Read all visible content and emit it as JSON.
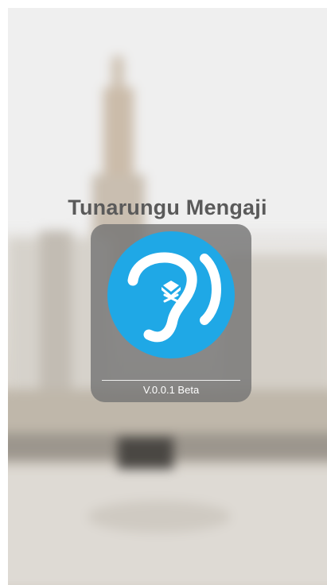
{
  "splash": {
    "app_title": "Tunarungu Mengaji",
    "version": "V.0.0.1 Beta"
  },
  "icons": {
    "logo": "ear-with-quran-icon"
  },
  "colors": {
    "logo_circle": "#1fa8e6",
    "title_text": "#5a5a5a",
    "card_background": "#737373"
  }
}
